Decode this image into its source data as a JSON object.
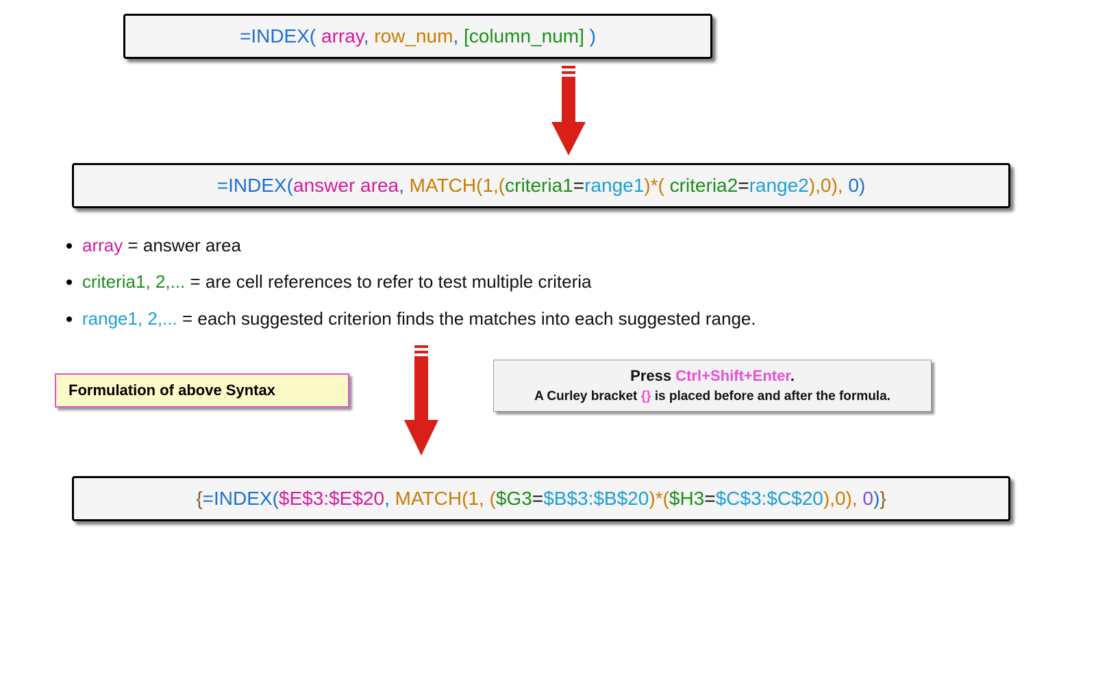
{
  "box1": {
    "p1": "=INDEX( ",
    "p2": "array",
    "p3": ", ",
    "p4": "row_num",
    "p5": ", ",
    "p6": "[column_num]",
    "p7": " )"
  },
  "box2": {
    "p1": "=INDEX(",
    "p2": "answer area",
    "p3": ", ",
    "p4": "MATCH(",
    "p5": "1",
    "p6": ",(",
    "p7": "criteria1",
    "p8": "=",
    "p9": "range1",
    "p10": ")*( ",
    "p11": "criteria2",
    "p12": "=",
    "p13": "range2",
    "p14": "),",
    "p15": "0",
    "p16": "), ",
    "p17": "0",
    "p18": ")"
  },
  "bullets": {
    "b1a": "array",
    "b1b": " = ",
    "b1c": "answer area",
    "b2a": "criteria1, 2,...",
    "b2b": " = ",
    "b2c": "are cell references to refer to test multiple criteria",
    "b3a": "range1, 2,...",
    "b3b": " = ",
    "b3c": "each suggested criterion finds the matches into each suggested range."
  },
  "label": "Formulation of above Syntax",
  "info": {
    "l1a": "Press ",
    "l1b": "Ctrl+Shift+Enter",
    "l1c": ".",
    "l2a": "A Curley bracket ",
    "l2b": "{}",
    "l2c": " is placed before and after the formula."
  },
  "box3": {
    "p1": "{",
    "p2": "=INDEX(",
    "p3": "$E$3:$E$20",
    "p4": ", ",
    "p5": "MATCH(",
    "p6": "1",
    "p7": ", (",
    "p8": "$G3",
    "p9": "=",
    "p10": "$B$3:$B$20",
    "p11": ")*(",
    "p12": "$H3",
    "p13": "=",
    "p14": "$C$3:$C$20",
    "p15": "),",
    "p16": "0",
    "p17": "), ",
    "p18": "0",
    "p19": ")",
    "p20": "}"
  },
  "colors": {
    "blue": "#1a6fd6",
    "magenta": "#d61aa0",
    "orange": "#cc7a00",
    "green": "#1a8f1a",
    "cyan": "#1aa0d6",
    "purple": "#7a4fd6",
    "brown": "#8a5a2a",
    "pink": "#e84fd6",
    "arrow": "#d81f18"
  }
}
